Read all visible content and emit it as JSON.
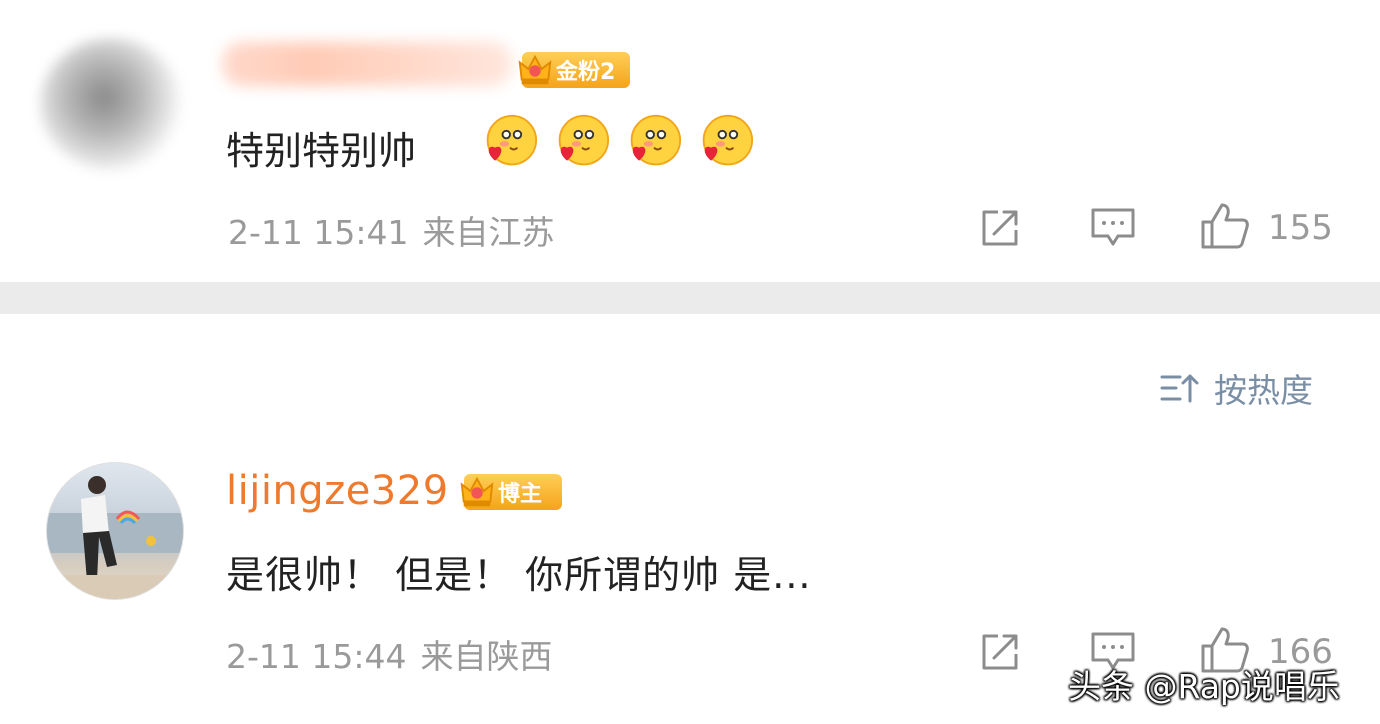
{
  "comments": [
    {
      "username": "",
      "badge": "金粉2",
      "text": "特别特别帅",
      "emoji_count": 4,
      "emoji_icon": "heart-face-emoji-icon",
      "time": "2-11 15:41",
      "location": "来自江苏",
      "likes": "155"
    },
    {
      "username": "lijingze329",
      "badge": "博主",
      "text": "是很帅！ 但是！ 你所谓的帅 是...",
      "time": "2-11 15:44",
      "location": "来自陕西",
      "likes": "166"
    }
  ],
  "sort": {
    "label": "按热度",
    "icon": "sort-icon"
  },
  "icons": {
    "share": "share-icon",
    "comment": "comment-icon",
    "like": "thumbs-up-icon",
    "badge": "crown-icon"
  },
  "watermark": "头条 @Rap说唱乐",
  "colors": {
    "username": "#f07a2c",
    "meta": "#9a9a9a",
    "badge": "#f5a31b",
    "sort": "#7a8fa6",
    "divider": "#ebebeb"
  }
}
